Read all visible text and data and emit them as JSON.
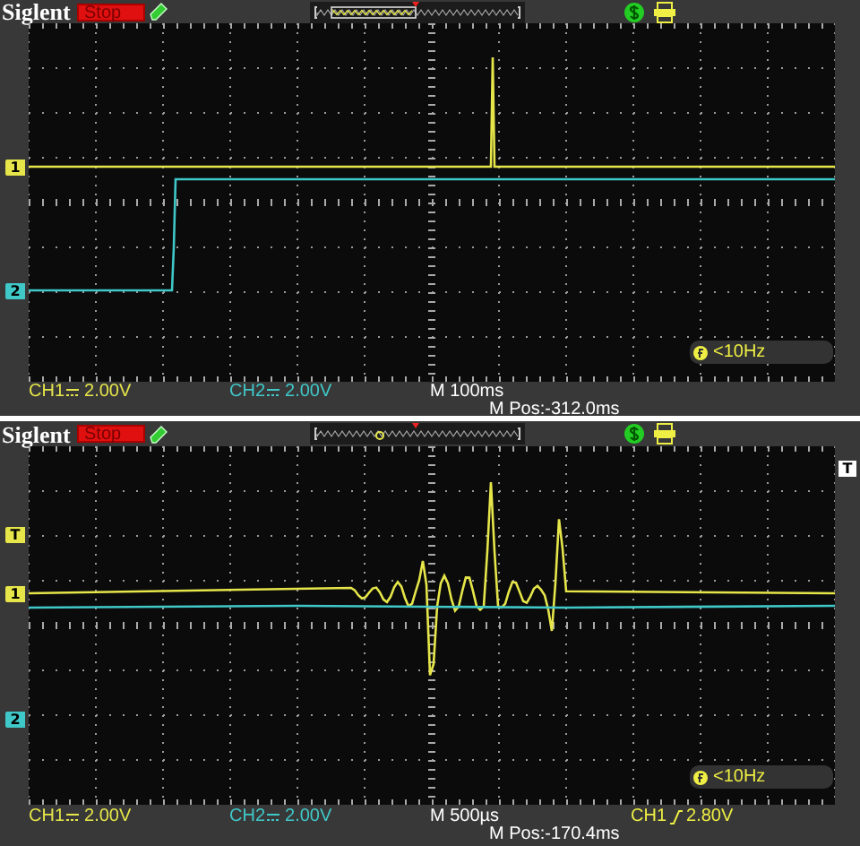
{
  "panels": [
    {
      "brand": "Siglent",
      "run_state": "Stop",
      "channels": [
        {
          "name": "CH1",
          "marker": "1",
          "scale": "2.00V",
          "color": "#e6e64a",
          "kind": "spike"
        },
        {
          "name": "CH2",
          "marker": "2",
          "scale": "2.00V",
          "color": "#40c8c8",
          "kind": "step"
        }
      ],
      "frequency": "<10Hz",
      "timebase": "M 100ms",
      "position": "M Pos:-312.0ms"
    },
    {
      "brand": "Siglent",
      "run_state": "Stop",
      "channels": [
        {
          "name": "CH1",
          "marker": "1",
          "scale": "2.00V",
          "color": "#e6e64a",
          "kind": "burst"
        },
        {
          "name": "CH2",
          "marker": "2",
          "scale": "2.00V",
          "color": "#40c8c8",
          "kind": "flat"
        }
      ],
      "trigger": {
        "level_marker": "T",
        "position_marker": "T",
        "source": "CH1",
        "level": "2.80V"
      },
      "frequency": "<10Hz",
      "timebase": "M 500µs",
      "position": "M Pos:-170.4ms"
    }
  ]
}
